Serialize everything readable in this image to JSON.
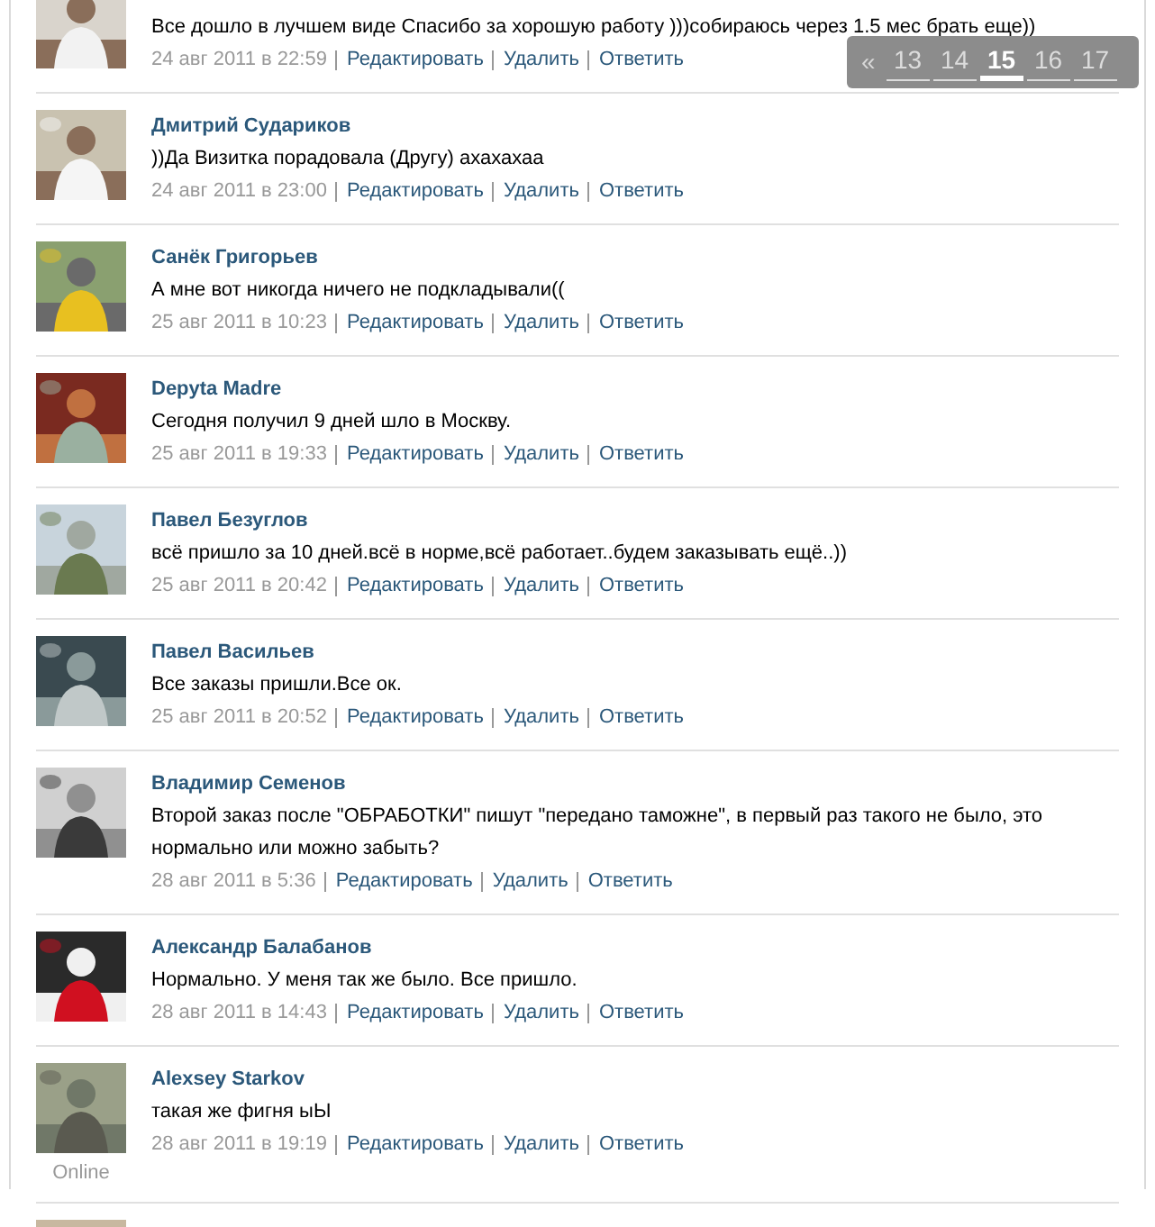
{
  "comments": [
    {
      "text": "Все дошло в лучшем виде Спасибо за хорошую работу )))собираюсь через 1.5 мес брать еще))",
      "date": "24 авг 2011 в 22:59",
      "actions": [
        "Редактировать",
        "Удалить",
        "Ответить"
      ]
    },
    {
      "name": "Дмитрий Судариков",
      "text": "))Да Визитка порадовала (Другу) ахахахаа",
      "date": "24 авг 2011 в 23:00",
      "actions": [
        "Редактировать",
        "Удалить",
        "Ответить"
      ]
    },
    {
      "name": "Санёк Григорьев",
      "text": "А мне вот никогда ничего не подкладывали((",
      "date": "25 авг 2011 в 10:23",
      "actions": [
        "Редактировать",
        "Удалить",
        "Ответить"
      ]
    },
    {
      "name": "Depyta Madre",
      "text": "Сегодня получил 9 дней шло в Москву.",
      "date": "25 авг 2011 в 19:33",
      "actions": [
        "Редактировать",
        "Удалить",
        "Ответить"
      ]
    },
    {
      "name": "Павел Безуглов",
      "text": "всё пришло за 10 дней.всё в норме,всё работает..будем заказывать ещё..))",
      "date": "25 авг 2011 в 20:42",
      "actions": [
        "Редактировать",
        "Удалить",
        "Ответить"
      ]
    },
    {
      "name": "Павел Васильев",
      "text": "Все заказы пришли.Все ок.",
      "date": "25 авг 2011 в 20:52",
      "actions": [
        "Редактировать",
        "Удалить",
        "Ответить"
      ]
    },
    {
      "name": "Владимир Семенов",
      "text": "Второй заказ после \"ОБРАБОТКИ\" пишут \"передано таможне\", в первый раз такого не было, это нормально или можно забыть?",
      "date": "28 авг 2011 в 5:36",
      "actions": [
        "Редактировать",
        "Удалить",
        "Ответить"
      ]
    },
    {
      "name": "Александр Балабанов",
      "text": "Нормально. У меня так же было. Все пришло.",
      "date": "28 авг 2011 в 14:43",
      "actions": [
        "Редактировать",
        "Удалить",
        "Ответить"
      ]
    },
    {
      "name": "Alexsey Starkov",
      "text": "такая же фигня ыЫ",
      "date": "28 авг 2011 в 19:19",
      "actions": [
        "Редактировать",
        "Удалить",
        "Ответить"
      ],
      "status": "Online"
    },
    {
      "avatar": {
        "kind": "picture"
      }
    }
  ],
  "pagination": {
    "prev": "«",
    "pages": [
      {
        "label": "13",
        "selected": false
      },
      {
        "label": "14",
        "selected": false
      },
      {
        "label": "15",
        "selected": true
      },
      {
        "label": "16",
        "selected": false
      },
      {
        "label": "17",
        "selected": false
      }
    ]
  }
}
